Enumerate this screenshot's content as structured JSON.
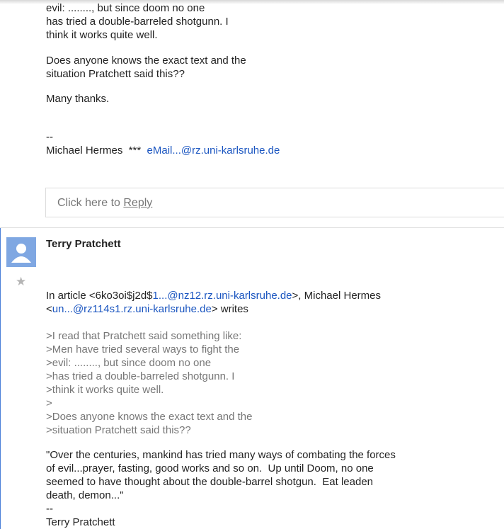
{
  "prev_message": {
    "lines": [
      "evil: ........, but since doom no one",
      "has tried a double-barreled shotgunn. I",
      "think it works quite well."
    ],
    "question_lines": [
      "Does anyone knows the exact text and the",
      "situation Pratchett said this??"
    ],
    "thanks": "Many thanks.",
    "sig_dash": "--",
    "sig_name": "Michael Hermes  ***  ",
    "sig_email": "eMail...@rz.uni-karlsruhe.de"
  },
  "reply": {
    "prefix": "Click here to ",
    "link": "Reply"
  },
  "message": {
    "author": "Terry Pratchett",
    "header": {
      "t1": "In article <6ko3oi$j2d$",
      "l1": "1...@nz12.rz.uni-karlsruhe.de",
      "t2": ">, Michael Hermes",
      "t3": "<",
      "l2": "un...@rz114s1.rz.uni-karlsruhe.de",
      "t4": "> writes"
    },
    "quoted": [
      ">I read that Pratchett said something like:",
      ">Men have tried several ways to fight the",
      ">evil: ........, but since doom no one",
      ">has tried a double-barreled shotgunn. I",
      ">think it works quite well.",
      ">",
      ">Does anyone knows the exact text and the",
      ">situation Pratchett said this??"
    ],
    "answer": [
      "\"Over the centuries, mankind has tried many ways of combating the forces",
      "of evil...prayer, fasting, good works and so on.  Up until Doom, no one",
      "seemed to have thought about the double-barrel shotgun.  Eat leaden",
      "death, demon...\""
    ],
    "sig_dash": "--",
    "sig_name": "Terry Pratchett"
  },
  "icons": {
    "avatar": "person-avatar-icon",
    "star": "star-icon"
  },
  "colors": {
    "link": "#1a55c0",
    "quoted": "#777777",
    "avatar": "#7fa7e2",
    "thread_bar": "#4a7fd8"
  }
}
